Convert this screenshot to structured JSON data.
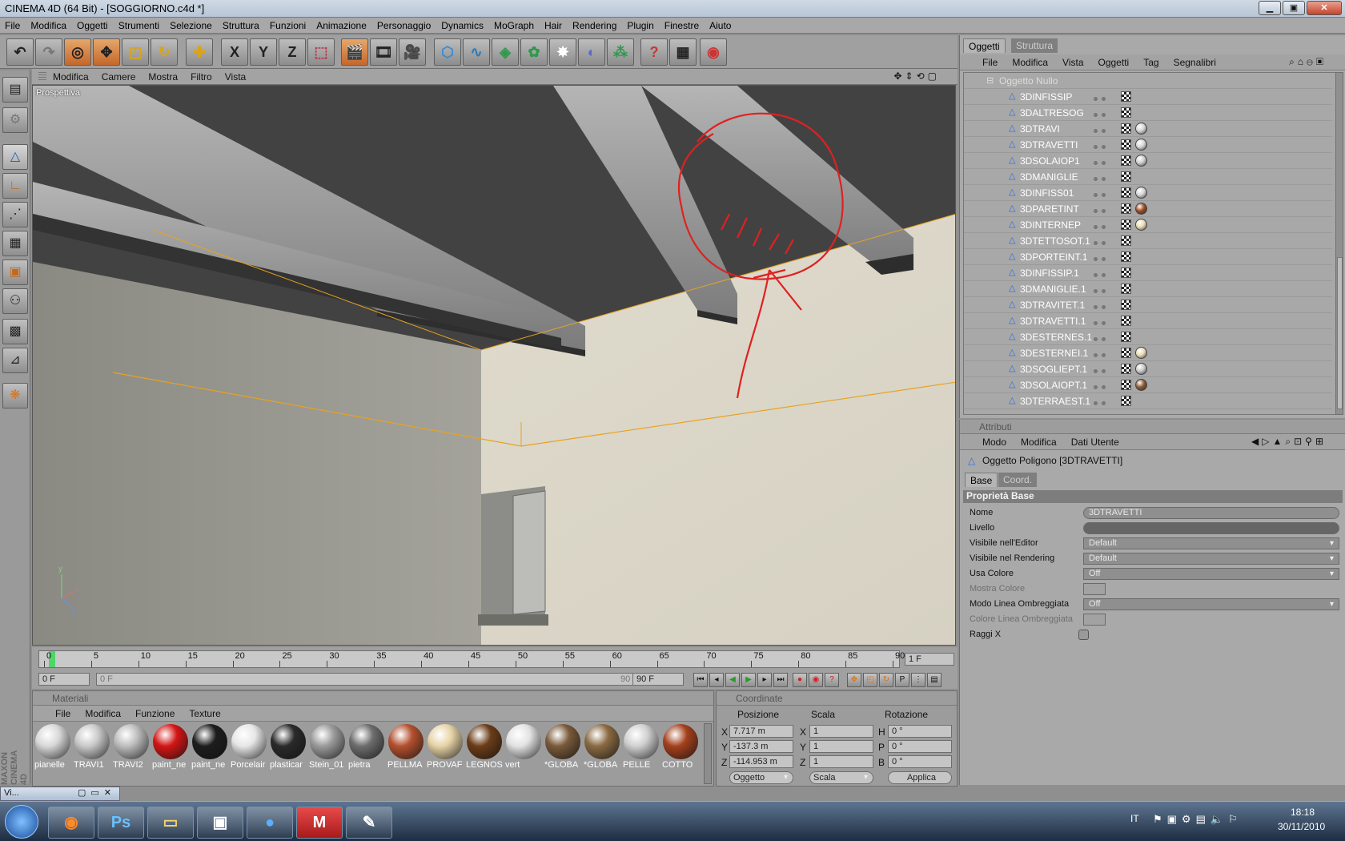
{
  "window": {
    "title": "CINEMA 4D (64 Bit) - [SOGGIORNO.c4d *]"
  },
  "menus": [
    "File",
    "Modifica",
    "Oggetti",
    "Strumenti",
    "Selezione",
    "Struttura",
    "Funzioni",
    "Animazione",
    "Personaggio",
    "Dynamics",
    "MoGraph",
    "Hair",
    "Rendering",
    "Plugin",
    "Finestre",
    "Aiuto"
  ],
  "toolbar": {
    "axis_x": "X",
    "axis_y": "Y",
    "axis_z": "Z"
  },
  "viewport": {
    "menu": [
      "Modifica",
      "Camere",
      "Mostra",
      "Filtro",
      "Vista"
    ],
    "label": "Prospettiva"
  },
  "timeline": {
    "ticks": [
      "0",
      "5",
      "10",
      "15",
      "20",
      "25",
      "30",
      "35",
      "40",
      "45",
      "50",
      "55",
      "60",
      "65",
      "70",
      "75",
      "80",
      "85",
      "90"
    ],
    "current_frame": "1 F",
    "start_frame": "0 F",
    "slider_start": "0 F",
    "slider_end": "90 F",
    "end_frame": "90 F"
  },
  "materials": {
    "header": "Materiali",
    "menu": [
      "File",
      "Modifica",
      "Funzione",
      "Texture"
    ],
    "items": [
      {
        "name": "pianelle",
        "color": "#d8d8d8"
      },
      {
        "name": "TRAVI1",
        "color": "#c9c9c9"
      },
      {
        "name": "TRAVI2",
        "color": "#bdbdbd"
      },
      {
        "name": "paint_ne",
        "color": "#d31515"
      },
      {
        "name": "paint_ne",
        "color": "#1d1d1d"
      },
      {
        "name": "Porcelair",
        "color": "#e6e6e6"
      },
      {
        "name": "plasticar",
        "color": "#2a2a2a"
      },
      {
        "name": "Stein_01",
        "color": "#9a9a9a"
      },
      {
        "name": "pietra",
        "color": "#6d6d6d"
      },
      {
        "name": "PELLMA",
        "color": "#b4502e"
      },
      {
        "name": "PROVAF",
        "color": "#e6d3a6"
      },
      {
        "name": "LEGNOS",
        "color": "#6b3d18"
      },
      {
        "name": "vert",
        "color": "#e2e2e2"
      },
      {
        "name": "*GLOBA",
        "color": "#7a5a3a"
      },
      {
        "name": "*GLOBA",
        "color": "#8a6a42"
      },
      {
        "name": "PELLE",
        "color": "#d0d0d0"
      },
      {
        "name": "COTTO",
        "color": "#a4401c"
      }
    ]
  },
  "coordinates": {
    "header": "Coordinate",
    "col_pos": "Posizione",
    "col_scale": "Scala",
    "col_rot": "Rotazione",
    "pos": {
      "x": "7.717 m",
      "y": "-137.3 m",
      "z": "-114.953 m"
    },
    "scale": {
      "x": "1",
      "y": "1",
      "z": "1"
    },
    "rot": {
      "h": "0 °",
      "p": "0 °",
      "b": "0 °"
    },
    "mode": "Oggetto",
    "scale_mode": "Scala",
    "apply": "Applica"
  },
  "objects_panel": {
    "tab_objects": "Oggetti",
    "tab_structure": "Struttura",
    "menu": [
      "File",
      "Modifica",
      "Vista",
      "Oggetti",
      "Tag",
      "Segnalibri"
    ],
    "parent": "Oggetto Nullo",
    "items": [
      {
        "name": "3DINFISSIP",
        "ball": ""
      },
      {
        "name": "3DALTRESOG",
        "ball": ""
      },
      {
        "name": "3DTRAVI",
        "ball": "#d6d6d6"
      },
      {
        "name": "3DTRAVETTI",
        "ball": "#d6d6d6"
      },
      {
        "name": "3DSOLAIOP1",
        "ball": "#cfcfcf"
      },
      {
        "name": "3DMANIGLIE",
        "ball": ""
      },
      {
        "name": "3DINFISS01",
        "ball": "#d6d6d6"
      },
      {
        "name": "3DPARETINT",
        "ball": "#9b4d22"
      },
      {
        "name": "3DINTERNEP",
        "ball": "#e8dcb6"
      },
      {
        "name": "3DTETTOSOT.1",
        "ball": ""
      },
      {
        "name": "3DPORTEINT.1",
        "ball": ""
      },
      {
        "name": "3DINFISSIP.1",
        "ball": ""
      },
      {
        "name": "3DMANIGLIE.1",
        "ball": ""
      },
      {
        "name": "3DTRAVITET.1",
        "ball": ""
      },
      {
        "name": "3DTRAVETTI.1",
        "ball": ""
      },
      {
        "name": "3DESTERNES.1",
        "ball": ""
      },
      {
        "name": "3DESTERNEI.1",
        "ball": "#e8dcb6"
      },
      {
        "name": "3DSOGLIEPT.1",
        "ball": "#c9c9c9"
      },
      {
        "name": "3DSOLAIOPT.1",
        "ball": "#8a5a32"
      },
      {
        "name": "3DTERRAEST.1",
        "ball": ""
      }
    ]
  },
  "attributes": {
    "header": "Attributi",
    "menu": [
      "Modo",
      "Modifica",
      "Dati Utente"
    ],
    "object_title": "Oggetto Poligono [3DTRAVETTI]",
    "tab_base": "Base",
    "tab_coord": "Coord.",
    "section": "Proprietà Base",
    "rows": [
      {
        "label": "Nome",
        "value": "3DTRAVETTI"
      },
      {
        "label": "Livello",
        "value": ""
      },
      {
        "label": "Visibile nell'Editor",
        "value": "Default"
      },
      {
        "label": "Visibile nel Rendering",
        "value": "Default"
      },
      {
        "label": "Usa Colore",
        "value": "Off"
      },
      {
        "label": "Mostra Colore",
        "value": ""
      },
      {
        "label": "Modo Linea Ombreggiata",
        "value": "Off"
      },
      {
        "label": "Colore Linea Ombreggiata",
        "value": ""
      },
      {
        "label": "Raggi X",
        "value": ""
      }
    ]
  },
  "brand": "MAXON CINEMA 4D",
  "taskbar": {
    "minimized": "Vi...",
    "lang": "IT",
    "time": "18:18",
    "date": "30/11/2010"
  }
}
